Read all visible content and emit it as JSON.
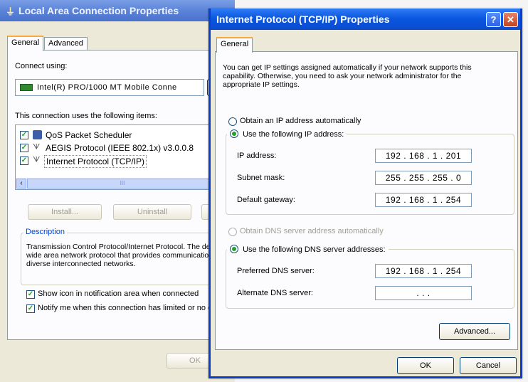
{
  "lac": {
    "title": "Local Area Connection Properties",
    "tabs": [
      "General",
      "Advanced"
    ],
    "connect_using_label": "Connect using:",
    "adapter_name": "Intel(R) PRO/1000 MT Mobile Conne",
    "items_label": "This connection uses the following items:",
    "items": [
      {
        "label": "QoS Packet Scheduler",
        "checked": true
      },
      {
        "label": "AEGIS Protocol (IEEE 802.1x) v3.0.0.8",
        "checked": true
      },
      {
        "label": "Internet Protocol (TCP/IP)",
        "checked": true
      }
    ],
    "scrollbar_text": "III",
    "install_label": "Install...",
    "uninstall_label": "Uninstall",
    "description_label": "Description",
    "description_text": "Transmission Control Protocol/Internet Protocol. The default wide area network protocol that provides communication across diverse interconnected networks.",
    "show_icon_label": "Show icon in notification area when connected",
    "notify_label": "Notify me when this connection has limited or no connectivity",
    "ok_label": "OK"
  },
  "ip": {
    "title": "Internet Protocol (TCP/IP) Properties",
    "help_glyph": "?",
    "close_glyph": "✕",
    "tab": "General",
    "intro": "You can get IP settings assigned automatically if your network supports this capability. Otherwise, you need to ask your network administrator for the appropriate IP settings.",
    "obtain_ip_label": "Obtain an IP address automatically",
    "use_ip_label": "Use the following IP address:",
    "ip_address_label": "IP address:",
    "ip_address_value": "192 . 168 .  1  . 201",
    "subnet_label": "Subnet mask:",
    "subnet_value": "255 . 255 . 255 .  0",
    "gateway_label": "Default gateway:",
    "gateway_value": "192 . 168 .  1  . 254",
    "obtain_dns_label": "Obtain DNS server address automatically",
    "use_dns_label": "Use the following DNS server addresses:",
    "preferred_dns_label": "Preferred DNS server:",
    "preferred_dns_value": "192 . 168 .  1  . 254",
    "alternate_dns_label": "Alternate DNS server:",
    "alternate_dns_value": ".        .        .",
    "advanced_label": "Advanced...",
    "ok_label": "OK",
    "cancel_label": "Cancel"
  },
  "colors": {
    "title_active": "#0b57e0",
    "title_inactive": "#7a9ee6",
    "dialog_bg": "#ece9d8",
    "tab_accent": "#f9a93a",
    "selection": "#316ac5"
  }
}
